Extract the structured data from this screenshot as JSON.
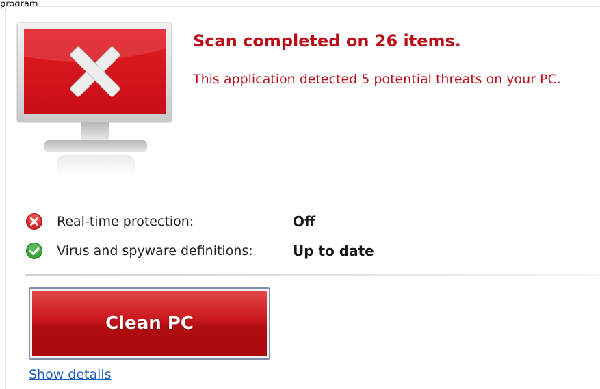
{
  "page_label": "program",
  "scan": {
    "title": "Scan completed on 26 items.",
    "subtitle": "This application detected 5 potential threats on your PC."
  },
  "status": {
    "rows": [
      {
        "label": "Real-time protection:",
        "value": "Off",
        "icon": "error-icon"
      },
      {
        "label": "Virus and spyware definitions:",
        "value": "Up to date",
        "icon": "check-icon"
      }
    ]
  },
  "actions": {
    "clean_label": "Clean PC",
    "details_label": "Show details"
  },
  "colors": {
    "accent": "#b8101a",
    "button": "#c8181c",
    "link": "#1d5bb8",
    "ok": "#3aa83a"
  }
}
